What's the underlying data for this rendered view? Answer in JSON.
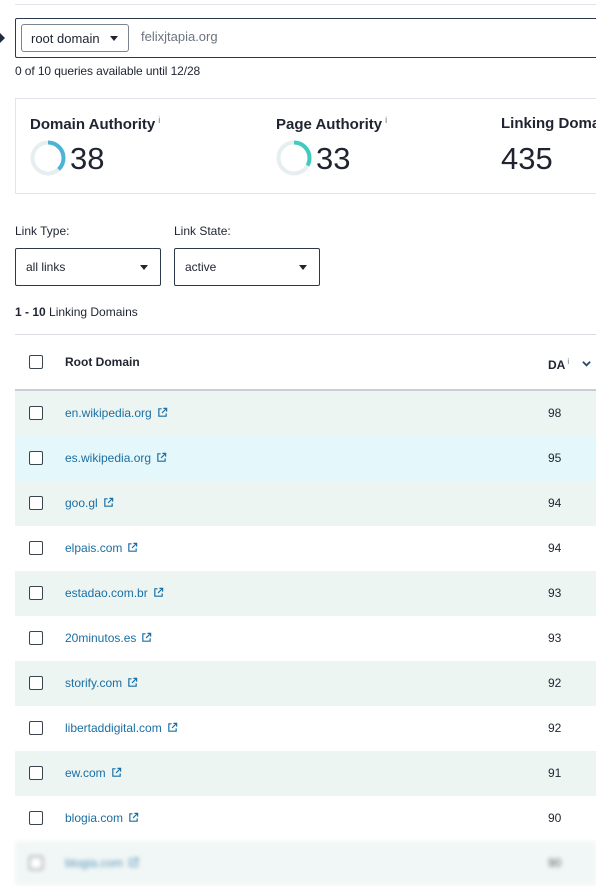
{
  "search": {
    "scope_label": "root domain",
    "query_value": "felixjtapia.org"
  },
  "quota_text": "0 of 10 queries available until 12/28",
  "metrics": [
    {
      "title": "Domain Authority",
      "info": "i",
      "value": "38",
      "fill": 0.38
    },
    {
      "title": "Page Authority",
      "info": "i",
      "value": "33",
      "fill": 0.33
    },
    {
      "title": "Linking Domains",
      "value": "435"
    }
  ],
  "filters": {
    "link_type": {
      "label": "Link Type:",
      "value": "all links"
    },
    "link_state": {
      "label": "Link State:",
      "value": "active"
    }
  },
  "range": {
    "span": "1 - 10",
    "label": "Linking Domains"
  },
  "table": {
    "header_root": "Root Domain",
    "header_da": "DA",
    "header_da_info": "i",
    "rows": [
      {
        "domain": "en.wikipedia.org",
        "da": "98"
      },
      {
        "domain": "es.wikipedia.org",
        "da": "95"
      },
      {
        "domain": "goo.gl",
        "da": "94"
      },
      {
        "domain": "elpais.com",
        "da": "94"
      },
      {
        "domain": "estadao.com.br",
        "da": "93"
      },
      {
        "domain": "20minutos.es",
        "da": "93"
      },
      {
        "domain": "storify.com",
        "da": "92"
      },
      {
        "domain": "libertaddigital.com",
        "da": "92"
      },
      {
        "domain": "ew.com",
        "da": "91"
      },
      {
        "domain": "blogia.com",
        "da": "90"
      },
      {
        "domain": "blogia.com",
        "da": "90"
      }
    ],
    "row_colors": [
      "#edf5f3",
      "#e4f7fb",
      "#edf5f3",
      "#ffffff",
      "#edf5f3",
      "#ffffff",
      "#edf5f3",
      "#ffffff",
      "#edf5f3",
      "#ffffff",
      "#edf5f3"
    ]
  },
  "colors": {
    "accent_ring": "#4ab3d6",
    "accent_ring_pa": "#3fcbbe",
    "ring_track": "#e6eef0",
    "link": "#1a6fa3"
  }
}
